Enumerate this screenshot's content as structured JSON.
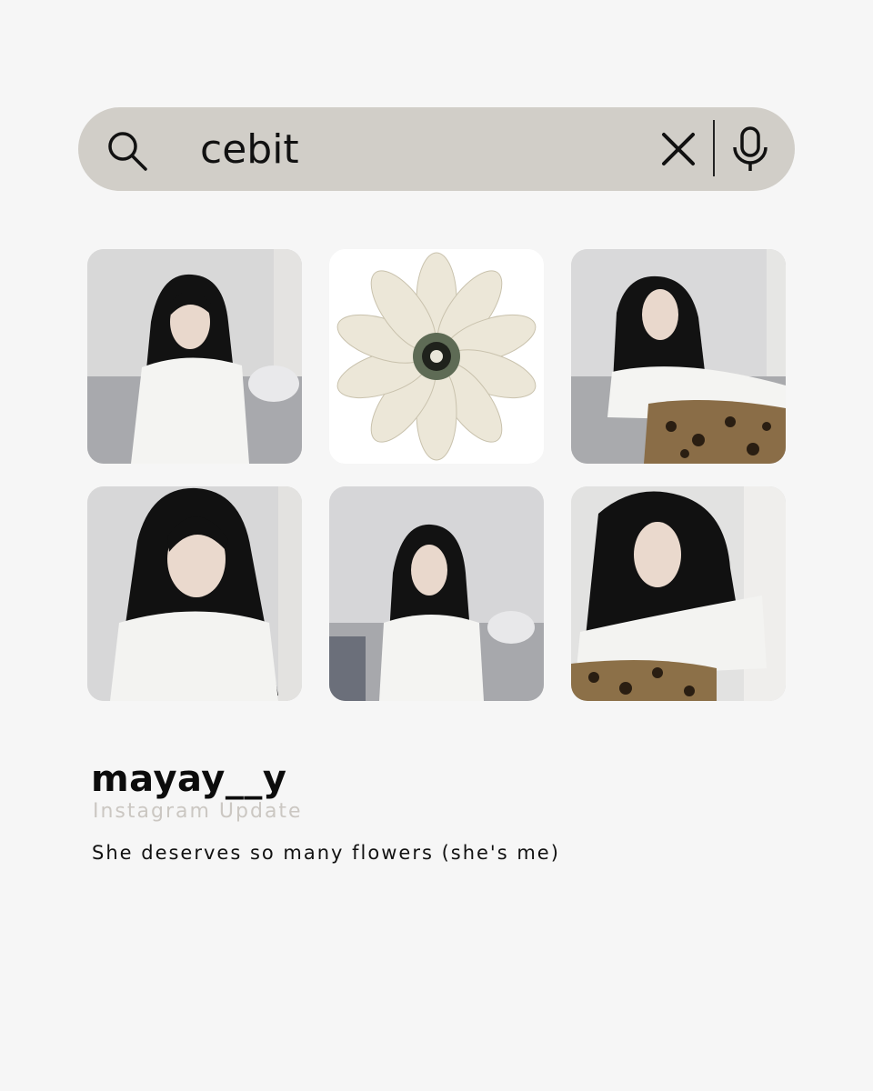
{
  "search": {
    "query": "cebit",
    "icons": {
      "search": "search-icon",
      "clear": "close-icon",
      "voice": "microphone-icon"
    }
  },
  "photo_grid": {
    "tiles": [
      {
        "content": "photo"
      },
      {
        "content": "flower"
      },
      {
        "content": "photo"
      },
      {
        "content": "photo"
      },
      {
        "content": "photo"
      },
      {
        "content": "photo"
      }
    ]
  },
  "post": {
    "username": "mayay__y",
    "subtitle": "Instagram Update",
    "caption": "She deserves so many flowers (she's me)"
  },
  "colors": {
    "background": "#f6f6f6",
    "search_bar": "#d1cec8",
    "subtitle": "#cbc7c2",
    "text": "#111111"
  }
}
